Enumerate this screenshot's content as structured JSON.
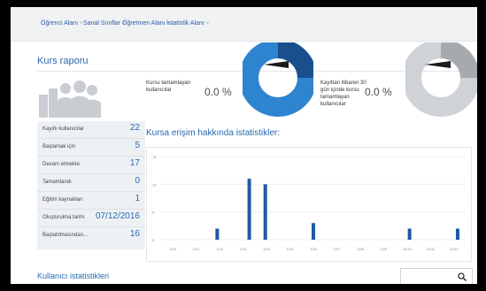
{
  "nav": {
    "items": [
      {
        "label": "Öğrenci Alanı"
      },
      {
        "label": "Sanal Sınıflar"
      },
      {
        "label": "Öğretmen Alanı"
      },
      {
        "label": "İstatistik Alanı"
      }
    ],
    "chevron": "˅"
  },
  "page": {
    "title": "Kurs raporu"
  },
  "stats": [
    {
      "label": "Kayıtlı kullanıcılar",
      "value": "22"
    },
    {
      "label": "Başlamak için",
      "value": "5"
    },
    {
      "label": "Devam etmekte",
      "value": "17"
    },
    {
      "label": "Tamamlandı",
      "value": "0"
    },
    {
      "label": "Eğitim kaynakları",
      "value": "1"
    },
    {
      "label": "Oluşturulma tarihi",
      "value": "07/12/2016"
    },
    {
      "label": "Başlatılmasından...",
      "value": "16"
    }
  ],
  "kpis": {
    "completed": {
      "label_lines": [
        "Kursu tamamlayan",
        "kullanıcılar"
      ],
      "value": "0.0 %",
      "donut_color": "#2f84d0"
    },
    "inactive": {
      "label_lines": [
        "Kayıttan itibaren 30",
        "gün içinde kursu",
        "tamamlayan",
        "kullanıcılar"
      ],
      "value": "0.0 %",
      "donut_color": "#b8bcc1"
    }
  },
  "section": {
    "title": "Kursa erişim hakkında istatistikler:"
  },
  "chart_data": {
    "type": "bar",
    "categories": [
      "12/05",
      "12/06",
      "12/07",
      "12/08",
      "12/09",
      "12/10",
      "12/11",
      "12/12",
      "12/13",
      "12/14",
      "12/15",
      "12/16",
      "12/17",
      "12/18",
      "12/19",
      "12/20",
      "12/21",
      "12/22",
      "12/23"
    ],
    "x_tick_labels": [
      "12/0",
      "12/1",
      "12/2",
      "12/3",
      "12/4",
      "12/5",
      "12/6",
      "12/7",
      "12/8",
      "12/9",
      "12/10",
      "12/11",
      "12/12"
    ],
    "y_ticks": [
      "15",
      "10",
      "5",
      "0"
    ],
    "ylim": [
      0,
      15
    ],
    "values": [
      0,
      0,
      0,
      2,
      0,
      11,
      10,
      0,
      0,
      3,
      0,
      0,
      0,
      0,
      0,
      2,
      0,
      0,
      2
    ],
    "bar_color": "#1d5aa3"
  },
  "bottom": {
    "title": "Kullanıcı istatistikleri",
    "search_icon": "magnifier"
  }
}
